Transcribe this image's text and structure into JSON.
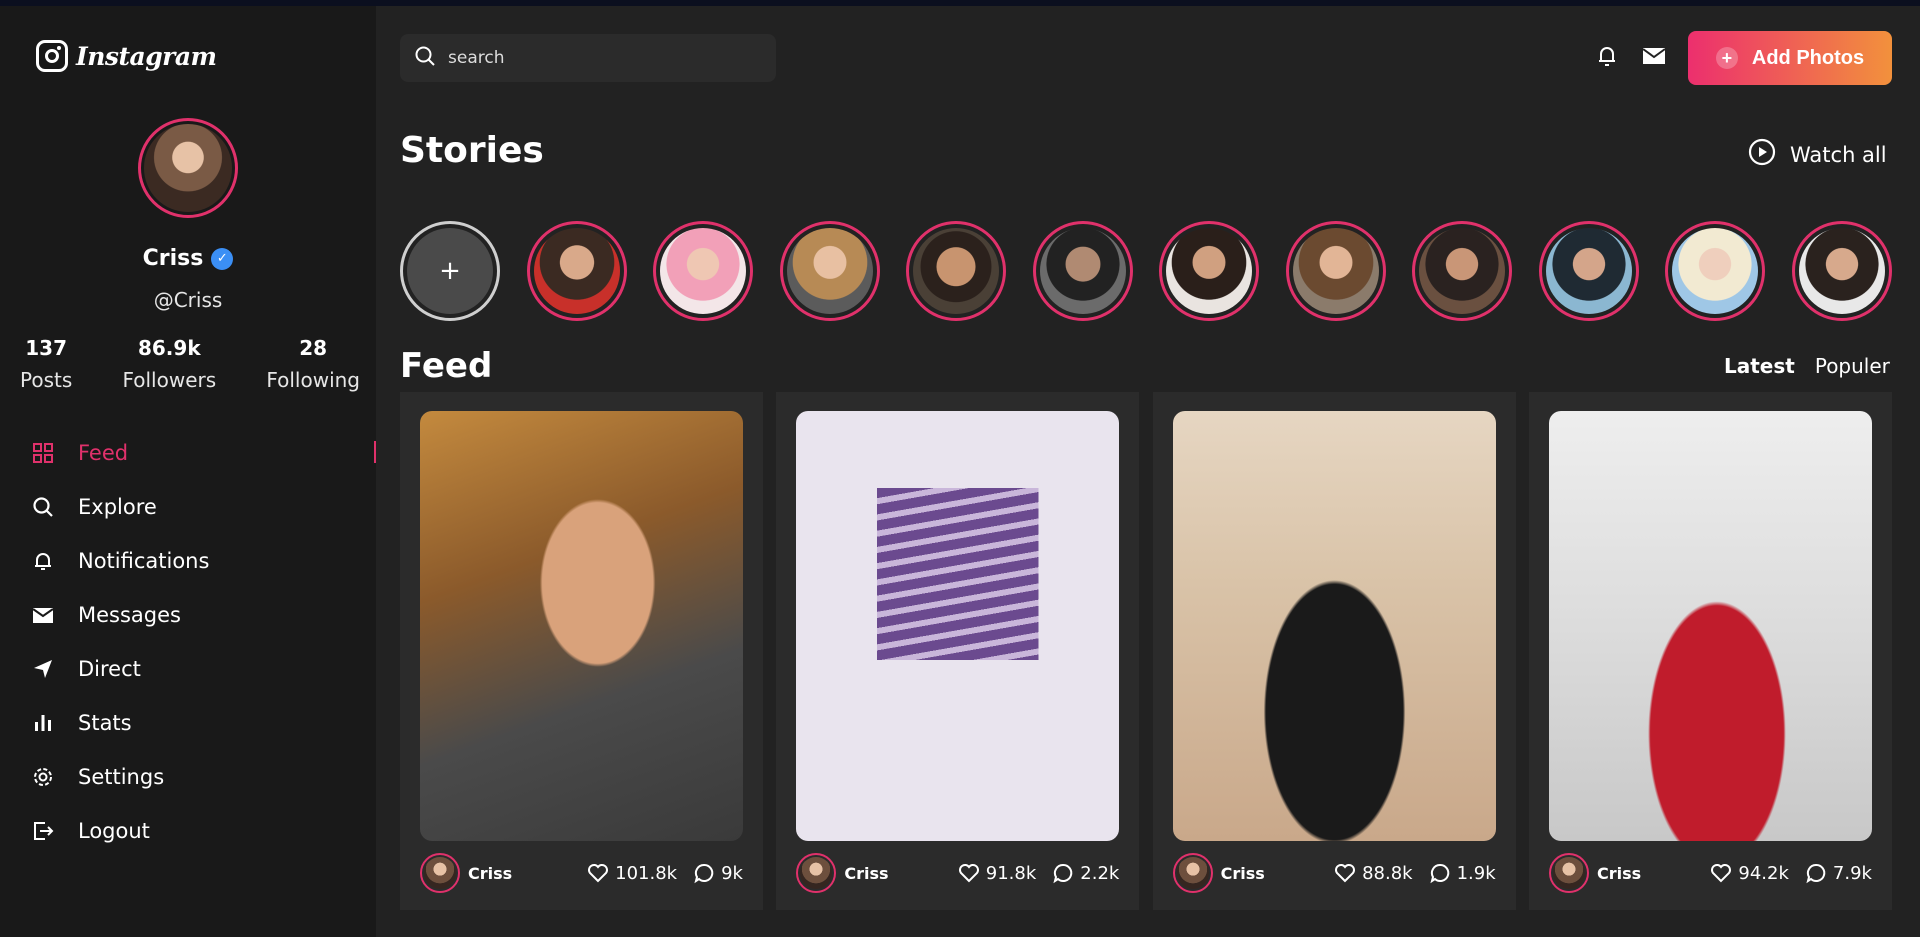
{
  "brand": {
    "name": "Instagram"
  },
  "profile": {
    "name": "Criss",
    "handle": "@Criss",
    "stats": [
      {
        "value": "137",
        "label": "Posts"
      },
      {
        "value": "86.9k",
        "label": "Followers"
      },
      {
        "value": "28",
        "label": "Following"
      }
    ]
  },
  "nav": [
    {
      "label": "Feed",
      "icon": "grid-icon",
      "active": true
    },
    {
      "label": "Explore",
      "icon": "search-icon"
    },
    {
      "label": "Notifications",
      "icon": "bell-icon"
    },
    {
      "label": "Messages",
      "icon": "mail-icon"
    },
    {
      "label": "Direct",
      "icon": "send-icon"
    },
    {
      "label": "Stats",
      "icon": "bar-chart-icon"
    },
    {
      "label": "Settings",
      "icon": "gear-icon"
    },
    {
      "label": "Logout",
      "icon": "logout-icon"
    }
  ],
  "header": {
    "search_placeholder": "search",
    "add_photos_label": "Add Photos"
  },
  "stories": {
    "title": "Stories",
    "watch_all_label": "Watch all",
    "add_symbol": "+"
  },
  "feed": {
    "title": "Feed",
    "tabs": [
      {
        "label": "Latest",
        "active": true
      },
      {
        "label": "Populer"
      }
    ],
    "posts": [
      {
        "user": "Criss",
        "likes": "101.8k",
        "comments": "9k"
      },
      {
        "user": "Criss",
        "likes": "91.8k",
        "comments": "2.2k"
      },
      {
        "user": "Criss",
        "likes": "88.8k",
        "comments": "1.9k"
      },
      {
        "user": "Criss",
        "likes": "94.2k",
        "comments": "7.9k"
      }
    ]
  },
  "colors": {
    "accent": "#e0316b",
    "gradient_start": "#ec2f6e",
    "gradient_end": "#f2913c",
    "sidebar_bg": "#191919",
    "main_bg": "#222222",
    "card_bg": "#2b2b2b",
    "verified": "#3b8ff5"
  }
}
